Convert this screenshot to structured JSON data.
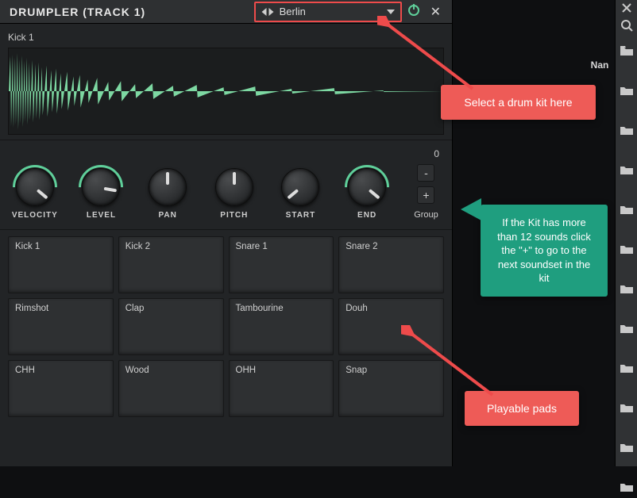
{
  "header": {
    "title": "DRUMPLER (TRACK 1)",
    "kit_name": "Berlin"
  },
  "sample": {
    "name": "Kick 1"
  },
  "knobs": {
    "velocity": "VELOCITY",
    "level": "LEVEL",
    "pan": "PAN",
    "pitch": "PITCH",
    "start": "START",
    "end": "END"
  },
  "group": {
    "value": "0",
    "label": "Group",
    "minus": "-",
    "plus": "+"
  },
  "pads": [
    "Kick 1",
    "Kick 2",
    "Snare 1",
    "Snare 2",
    "Rimshot",
    "Clap",
    "Tambourine",
    "Douh",
    "CHH",
    "Wood",
    "OHH",
    "Snap"
  ],
  "panel": {
    "nan_label": "Nan"
  },
  "callouts": {
    "select_kit": "Select a drum kit here",
    "group_tip": "If the Kit has more than 12 sounds click the \"+\"  to go to the next soundset in the kit",
    "pads_tip": "Playable pads"
  }
}
